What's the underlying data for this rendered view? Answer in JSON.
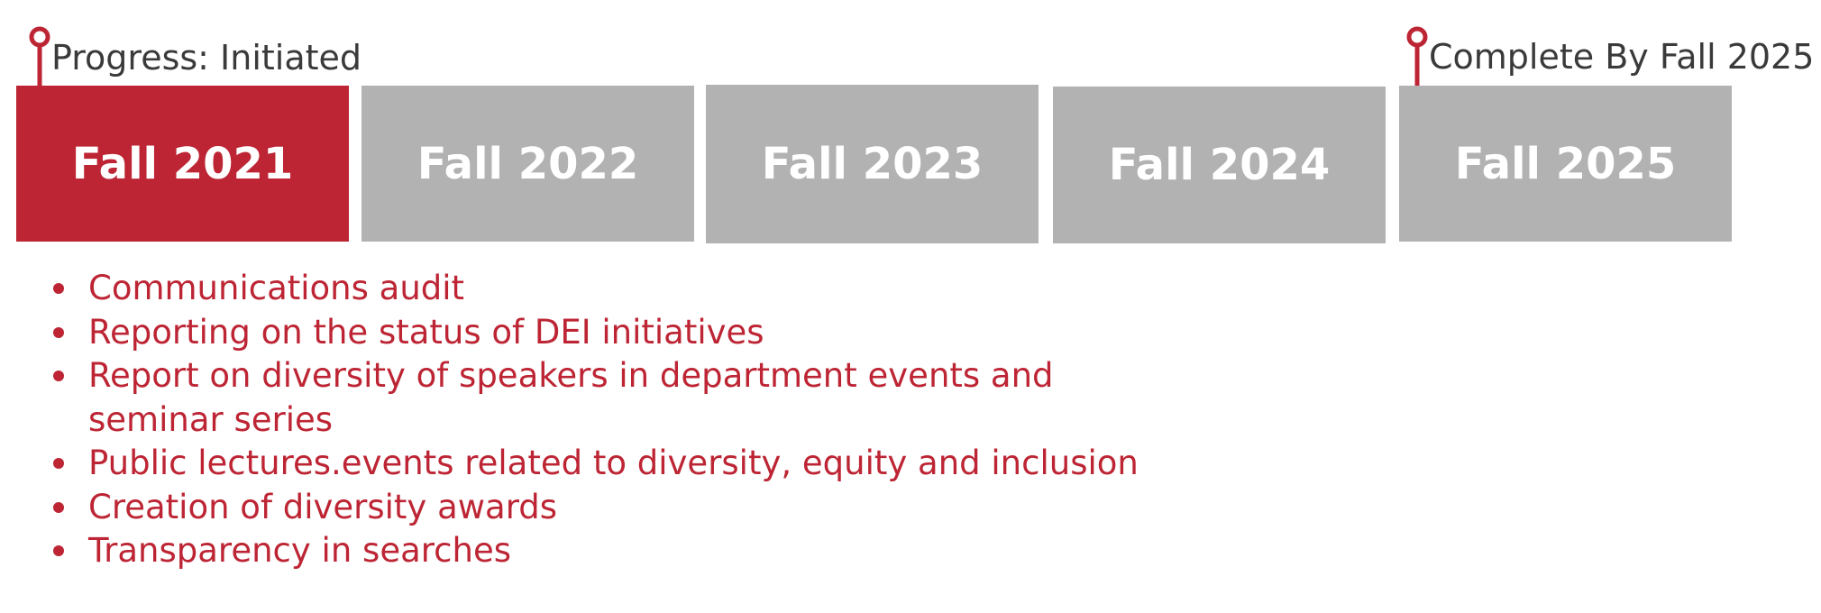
{
  "colors": {
    "accent": "#bd2534",
    "inactive": "#b2b2b2",
    "label": "#3a3a3a"
  },
  "markers": {
    "start": {
      "label": "Progress: Initiated",
      "icon": "pin-marker-icon"
    },
    "end": {
      "label": "Complete By Fall 2025",
      "icon": "pin-marker-icon"
    }
  },
  "timeline": [
    {
      "label": "Fall 2021",
      "active": true
    },
    {
      "label": "Fall 2022",
      "active": false
    },
    {
      "label": "Fall 2023",
      "active": false
    },
    {
      "label": "Fall 2024",
      "active": false
    },
    {
      "label": "Fall 2025",
      "active": false
    }
  ],
  "items": [
    "Communications audit",
    "Reporting on the status of DEI initiatives",
    "Report on diversity of speakers in department events and",
    "seminar series",
    "Public lectures.events related to diversity, equity and inclusion",
    "Creation of diversity awards",
    "Transparency in searches"
  ]
}
